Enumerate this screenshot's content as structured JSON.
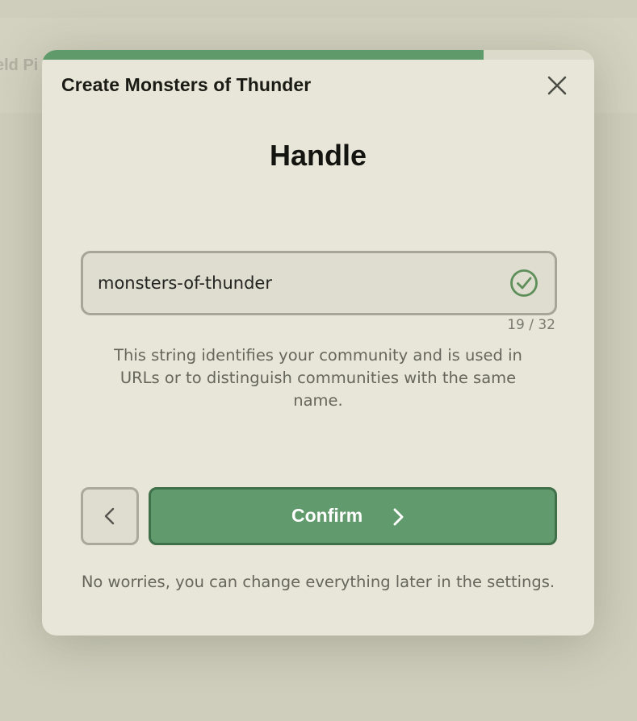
{
  "background": {
    "partial_text": "eld Pi"
  },
  "modal": {
    "title": "Create Monsters of Thunder",
    "progress": 0.8,
    "close_icon": "close-icon",
    "heading": "Handle",
    "input": {
      "value": "monsters-of-thunder",
      "status_icon": "check-circle-icon",
      "char_count": "19 / 32"
    },
    "help_text": "This string identifies your community and is used in URLs or to distinguish communities with the same name.",
    "back_icon": "chevron-left-icon",
    "confirm_label": "Confirm",
    "confirm_icon": "chevron-right-icon",
    "footer_note": "No worries, you can change everything later in the settings."
  },
  "colors": {
    "accent": "#619a6c",
    "accent_border": "#3f7049",
    "modal_bg": "#e8e6d8",
    "check": "#5e8f5a"
  }
}
